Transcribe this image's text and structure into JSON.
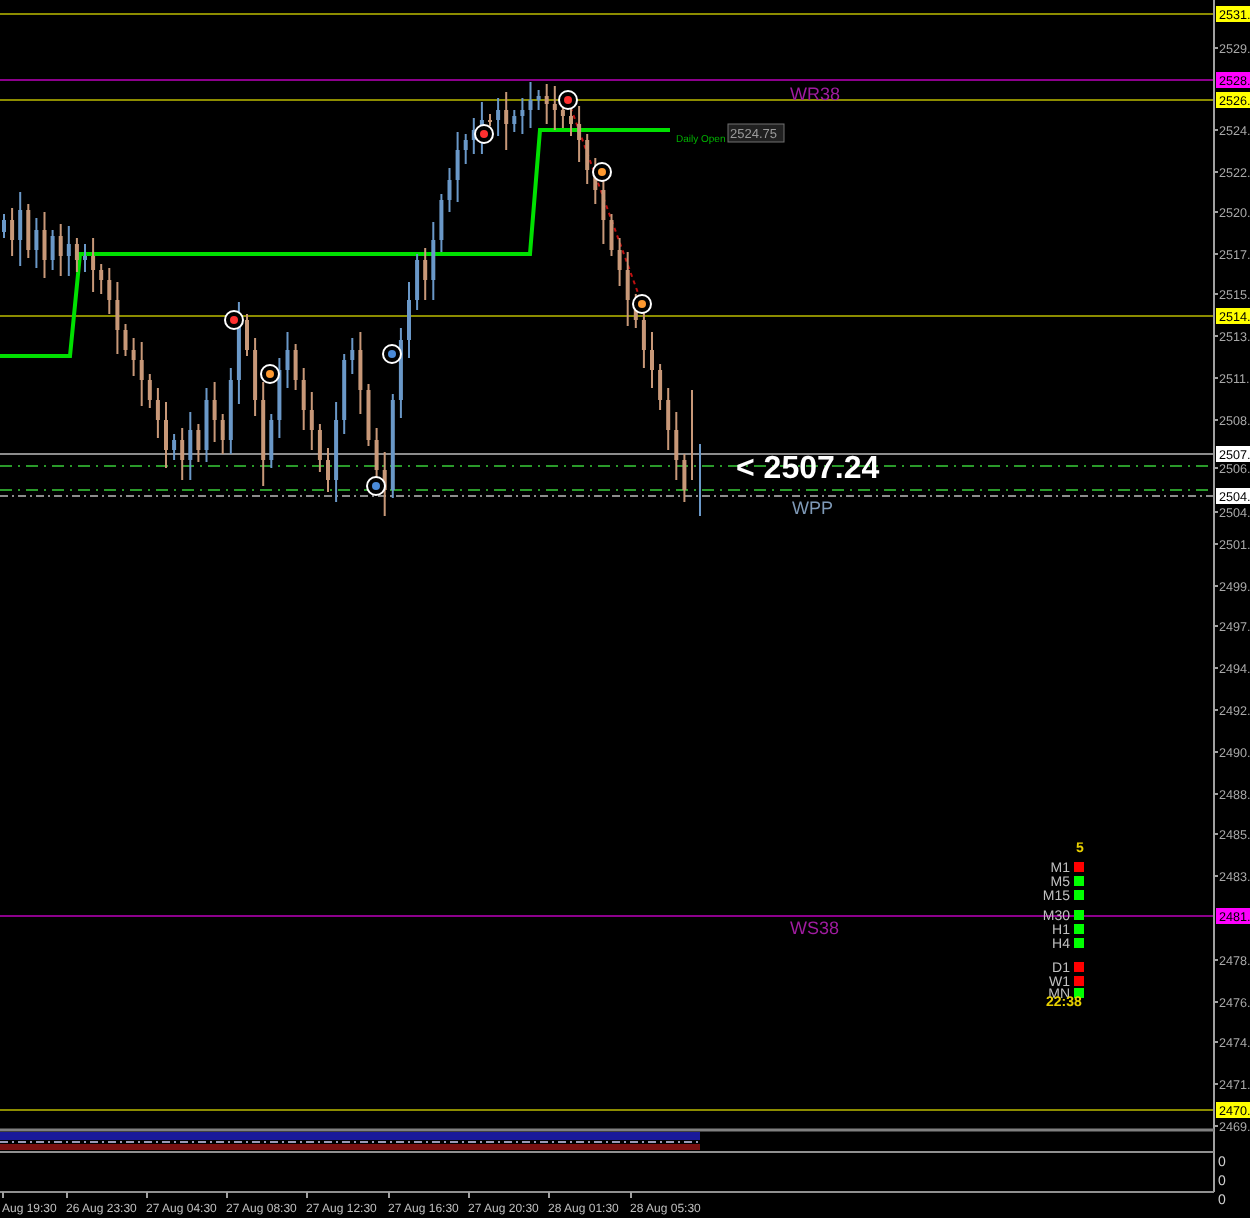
{
  "price_axis": {
    "ticks": [
      "2529.",
      "2524.",
      "2522.",
      "2520.",
      "2517.",
      "2515.",
      "2513.",
      "2511.",
      "2508.",
      "2506.",
      "2504.",
      "2501.",
      "2499.",
      "2497.",
      "2494.",
      "2492.",
      "2490.",
      "2488.",
      "2485.",
      "2483.",
      "2478.",
      "2476.",
      "2474.",
      "2471.",
      "2469."
    ]
  },
  "level_tags": [
    {
      "text": "2531.",
      "color": "#ffff00"
    },
    {
      "text": "2528.",
      "color": "#ff00ff"
    },
    {
      "text": "2526.",
      "color": "#ffff00"
    },
    {
      "text": "2514.",
      "color": "#ffff00"
    },
    {
      "text": "2507.",
      "color": "#ffffff"
    },
    {
      "text": "2504.",
      "color": "#ffffff"
    },
    {
      "text": "2481.",
      "color": "#ff00ff"
    },
    {
      "text": "2470.",
      "color": "#ffff00"
    }
  ],
  "pivot_labels": [
    {
      "text": "WR38",
      "color": "#a01ca0"
    },
    {
      "text": "WPP",
      "color": "#7f9ab8"
    },
    {
      "text": "WS38",
      "color": "#a01ca0"
    }
  ],
  "price_marker": {
    "text": "< 2507.24"
  },
  "daily_open": {
    "label": "Daily Open",
    "price": "2524.75"
  },
  "timeframes": {
    "count": "5",
    "items": [
      {
        "label": "M1",
        "color": "#ff0000"
      },
      {
        "label": "M5",
        "color": "#00ff00"
      },
      {
        "label": "M15",
        "color": "#00ff00"
      },
      {
        "label": "M30",
        "color": "#00ff00"
      },
      {
        "label": "H1",
        "color": "#00ff00"
      },
      {
        "label": "H4",
        "color": "#00ff00"
      },
      {
        "label": "D1",
        "color": "#ff0000"
      },
      {
        "label": "W1",
        "color": "#ff0000"
      },
      {
        "label": "MN",
        "color": "#00ff00"
      }
    ],
    "time": "22:38"
  },
  "indicator_axis": [
    "0",
    "0",
    "0"
  ],
  "time_axis": [
    "Aug 19:30",
    "26 Aug 23:30",
    "27 Aug 04:30",
    "27 Aug 08:30",
    "27 Aug 12:30",
    "27 Aug 16:30",
    "27 Aug 20:30",
    "28 Aug 01:30",
    "28 Aug 05:30"
  ]
}
